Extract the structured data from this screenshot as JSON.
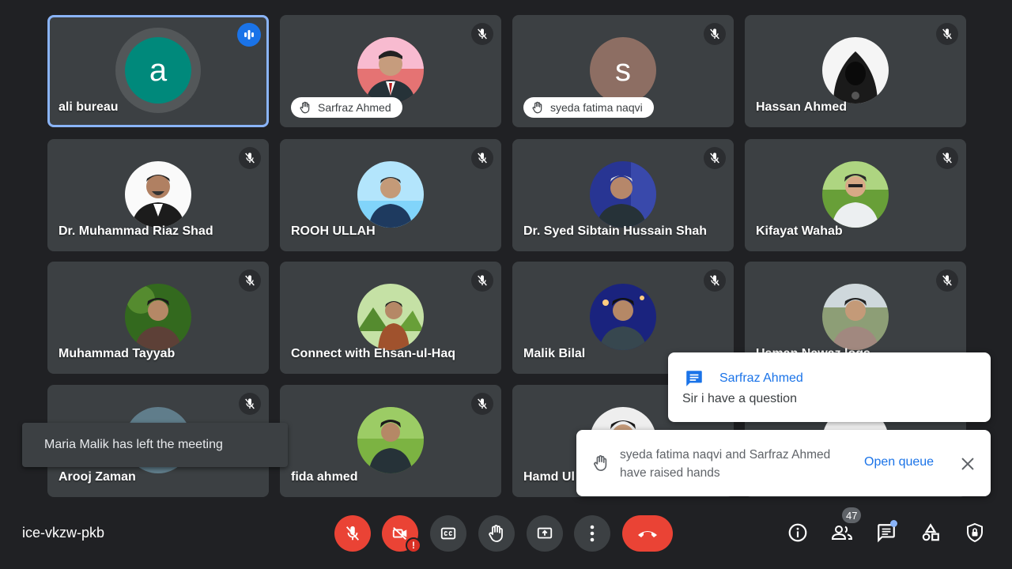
{
  "participants": [
    {
      "name": "ali bureau",
      "initial": "a",
      "avatar_color": "#00897b",
      "speaking": true
    },
    {
      "name": "Sarfraz Ahmed",
      "hand_raised": true
    },
    {
      "name": "syeda fatima naqvi",
      "initial": "s",
      "avatar_color": "#8d6e63",
      "hand_raised": true
    },
    {
      "name": "Hassan Ahmed"
    },
    {
      "name": "Dr. Muhammad Riaz Shad"
    },
    {
      "name": "ROOH ULLAH"
    },
    {
      "name": "Dr. Syed Sibtain Hussain Shah"
    },
    {
      "name": "Kifayat Wahab"
    },
    {
      "name": "Muhammad Tayyab"
    },
    {
      "name": "Connect with Ehsan-ul-Haq"
    },
    {
      "name": "Malik Bilal"
    },
    {
      "name": "Usman Nawaz logs"
    },
    {
      "name": "Arooj Zaman"
    },
    {
      "name": "fida ahmed"
    },
    {
      "name": "Hamd Ul"
    }
  ],
  "toast": {
    "text": "Maria Malik has left the meeting"
  },
  "chat_notification": {
    "sender": "Sarfraz Ahmed",
    "message": "Sir i have a question"
  },
  "hand_notification": {
    "text": "syeda fatima naqvi and Sarfraz Ahmed have raised hands",
    "action": "Open queue"
  },
  "meeting": {
    "code": "ice-vkzw-pkb",
    "participant_count": "47"
  },
  "colors": {
    "background": "#202124",
    "tile": "#3c4043",
    "danger": "#ea4335",
    "accent": "#1a73e8",
    "active_outline": "#8ab4f8"
  }
}
